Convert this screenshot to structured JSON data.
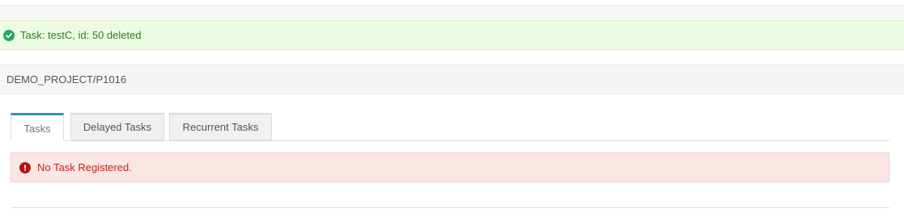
{
  "notifications": {
    "success_message": "Task: testC, id: 50 deleted",
    "success_color": "#2a7f1e"
  },
  "project": {
    "path": "DEMO_PROJECT/P1016"
  },
  "tabs": [
    {
      "label": "Tasks",
      "active": true
    },
    {
      "label": "Delayed Tasks",
      "active": false
    },
    {
      "label": "Recurrent Tasks",
      "active": false
    }
  ],
  "tab_accent_color": "#3c8dbc",
  "empty_state": {
    "message": "No Task Registered.",
    "color": "#c7221a"
  },
  "icons": {
    "success": "check-circle-icon",
    "error": "exclamation-circle-icon"
  }
}
